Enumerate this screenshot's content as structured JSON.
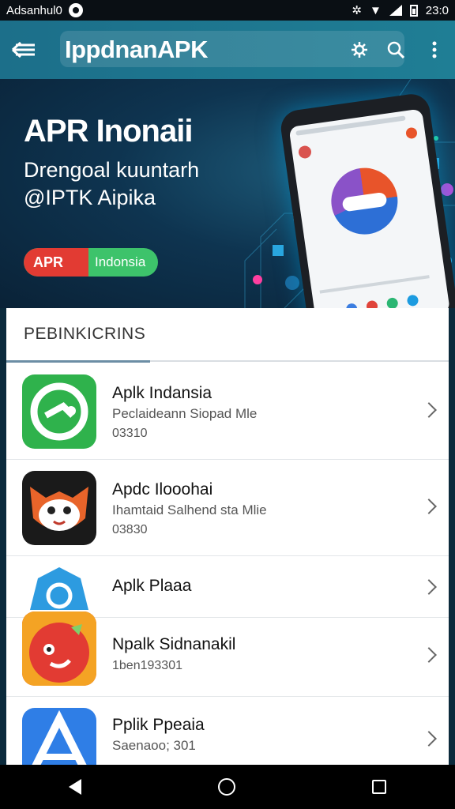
{
  "status_bar": {
    "left_text": "Adsanhul0",
    "time": "23:0"
  },
  "app_bar": {
    "title": "IppdnanAPK",
    "icons": [
      "back-arrow-icon",
      "gear-icon",
      "search-icon",
      "more-vert-icon"
    ]
  },
  "banner": {
    "title": "APR Inonaii",
    "subtitle_line1": "Drengoal kuuntarh",
    "subtitle_line2": "@IPTK Aipika",
    "badge_red": "APR",
    "badge_green": "Indonsia"
  },
  "section": {
    "title": "PEBINKICRINS"
  },
  "apps": [
    {
      "title": "Aplk Indansia",
      "subtitle": "Peclaideann Siopad Mle",
      "version": "03310",
      "icon": "green-app-icon"
    },
    {
      "title": "Apdc Ilooohai",
      "subtitle": "Ihamtaid Salhend sta Mlie",
      "version": "03830",
      "icon": "fox-app-icon"
    },
    {
      "title": "Aplk Plaaa",
      "subtitle": "",
      "version": "",
      "icon": "blue-app-icon"
    },
    {
      "title": "Npalk Sidnanakil",
      "subtitle": "",
      "version": "1ben193301",
      "icon": "red-app-icon"
    },
    {
      "title": "Pplik Ppeaia",
      "subtitle": "Saenaoo; 301",
      "version": "",
      "icon": "triangle-app-icon"
    }
  ],
  "colors": {
    "app_bar": "#1f7e95",
    "accent_green": "#3dc36b",
    "accent_red": "#e23b33"
  }
}
